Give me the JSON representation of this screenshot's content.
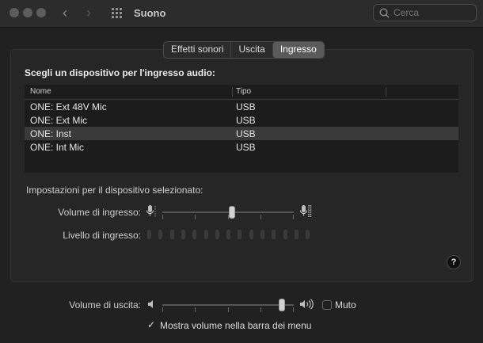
{
  "window": {
    "title": "Suono"
  },
  "search": {
    "placeholder": "Cerca",
    "value": ""
  },
  "tabs": [
    {
      "label": "Effetti sonori",
      "active": false
    },
    {
      "label": "Uscita",
      "active": false
    },
    {
      "label": "Ingresso",
      "active": true
    }
  ],
  "input": {
    "heading": "Scegli un dispositivo per l'ingresso audio:",
    "columns": [
      "Nome",
      "Tipo"
    ],
    "devices": [
      {
        "name": "ONE: Ext 48V Mic",
        "type": "USB",
        "selected": false
      },
      {
        "name": "ONE: Ext Mic",
        "type": "USB",
        "selected": false
      },
      {
        "name": "ONE: Inst",
        "type": "USB",
        "selected": true
      },
      {
        "name": "ONE: Int Mic",
        "type": "USB",
        "selected": false
      }
    ],
    "settings_label": "Impostazioni per il dispositivo selezionato:",
    "input_volume_label": "Volume di ingresso:",
    "input_volume_fraction": 0.53,
    "input_level_label": "Livello di ingresso:",
    "input_level_active_bars": 0
  },
  "output": {
    "volume_label": "Volume di uscita:",
    "volume_fraction": 0.93,
    "mute_label": "Muto",
    "mute_checked": false,
    "menu_bar_label": "Mostra volume nella barra dei menu",
    "menu_bar_checked": true
  },
  "help_label": "?",
  "icons": {
    "back": "chevron-left-icon",
    "forward": "chevron-right-icon",
    "grid": "grid-icon",
    "search": "search-icon",
    "mic_low": "microphone-low-icon",
    "mic_high": "microphone-high-icon",
    "speaker_low": "speaker-low-icon",
    "speaker_high": "speaker-high-icon",
    "check": "checkmark-icon"
  }
}
